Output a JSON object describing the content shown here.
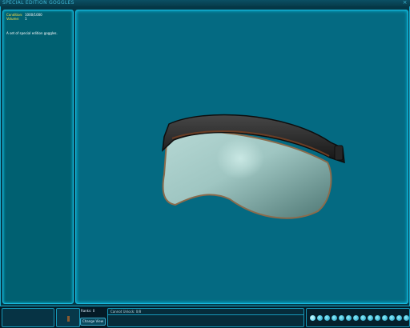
{
  "window": {
    "title": "SPECIAL EDITION GOGGLES",
    "close_glyph": "×"
  },
  "item": {
    "stats": [
      {
        "label": "Condition:",
        "value": "1000/1000"
      },
      {
        "label": "Volume:",
        "value": "1"
      }
    ],
    "description": "A set of special edition goggles."
  },
  "bottom": {
    "ranks_label": "Ranks: 0",
    "change_view_label": "Change View",
    "info_text": "Cannot Unlock: 0/8"
  },
  "toolbar": {
    "icons": [
      "inventory-icon",
      "character-icon",
      "map-icon",
      "journal-icon",
      "datapad-icon",
      "community-icon",
      "skills-icon",
      "abilities-icon",
      "crafting-icon",
      "settings-icon",
      "mail-icon",
      "help-icon",
      "options-icon",
      "quest-icon",
      "radar-icon"
    ]
  },
  "colors": {
    "accent": "#1bb8dc",
    "panel": "#006071",
    "viewport": "#046a82",
    "stat_label": "#ffe24a"
  }
}
